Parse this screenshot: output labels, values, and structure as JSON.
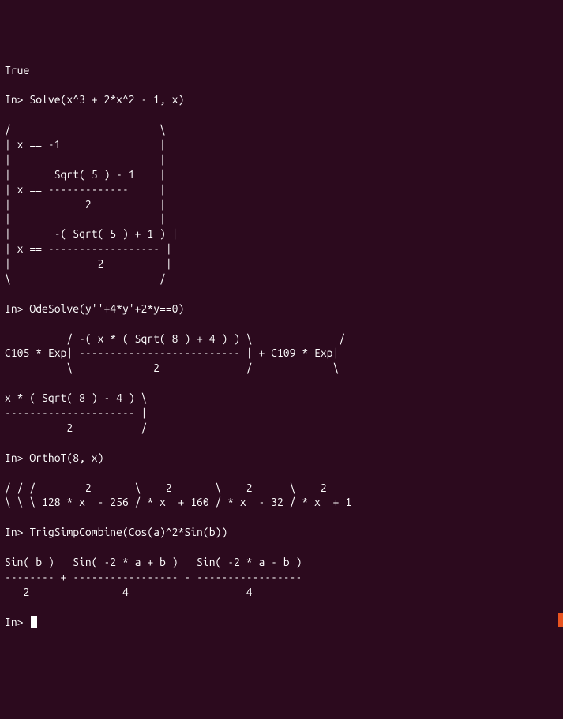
{
  "terminal": {
    "output": "True\n\nIn> Solve(x^3 + 2*x^2 - 1, x)\n\n/                        \\\n| x == -1                |\n|                        |\n|       Sqrt( 5 ) - 1    |\n| x == -------------     |\n|            2           |\n|                        |\n|       -( Sqrt( 5 ) + 1 ) |\n| x == ------------------ |\n|              2          |\n\\                        /\n\nIn> OdeSolve(y''+4*y'+2*y==0)\n\n          / -( x * ( Sqrt( 8 ) + 4 ) ) \\              /\nC105 * Exp| -------------------------- | + C109 * Exp|\n          \\             2              /             \\\n\nx * ( Sqrt( 8 ) - 4 ) \\\n--------------------- |\n          2           /\n\nIn> OrthoT(8, x)\n\n/ / /        2       \\    2       \\    2      \\    2\n\\ \\ \\ 128 * x  - 256 / * x  + 160 / * x  - 32 / * x  + 1\n\nIn> TrigSimpCombine(Cos(a)^2*Sin(b))\n\nSin( b )   Sin( -2 * a + b )   Sin( -2 * a - b )\n-------- + ----------------- - -----------------\n   2               4                   4\n",
    "prompt": "In> "
  }
}
